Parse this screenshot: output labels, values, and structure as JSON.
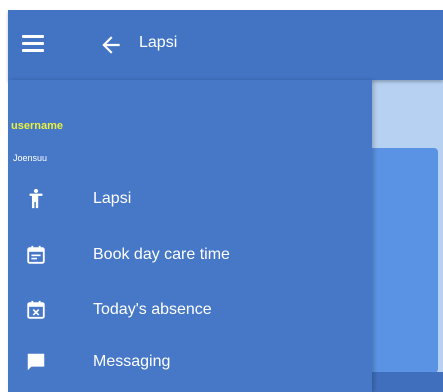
{
  "appbar": {
    "title": "Lapsi",
    "menu_icon": "hamburger-menu-icon",
    "back_icon": "arrow-back-icon"
  },
  "drawer": {
    "username": "username",
    "location": "Joensuu",
    "items": [
      {
        "label": "Lapsi",
        "icon": "child-icon"
      },
      {
        "label": "Book day care time",
        "icon": "calendar-note-icon"
      },
      {
        "label": "Today's absence",
        "icon": "calendar-x-icon"
      },
      {
        "label": "Messaging",
        "icon": "chat-bubble-icon"
      }
    ]
  },
  "colors": {
    "appbar": "#4374c4",
    "drawer": "#4678c7",
    "username_text": "#e8f040",
    "content_light": "#b6d1f2",
    "content_card": "#5a93e4"
  }
}
